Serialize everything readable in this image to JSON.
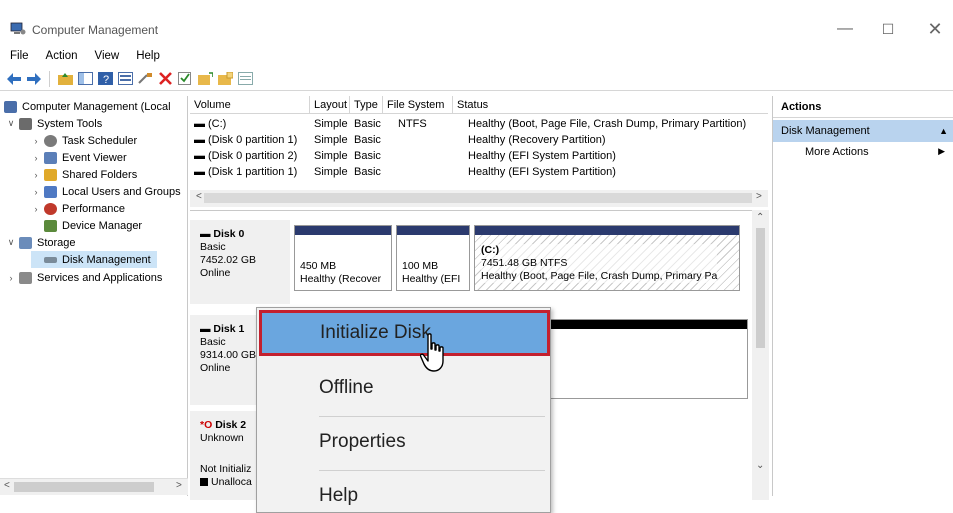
{
  "window": {
    "title": "Computer Management"
  },
  "menu": [
    "File",
    "Action",
    "View",
    "Help"
  ],
  "tree": {
    "items": [
      {
        "label": "Computer Management (Local",
        "expander": "",
        "icon_color": "#4a6ea9"
      },
      {
        "label": "System Tools",
        "expander": "∨",
        "icon_color": "#6b6b6b"
      },
      {
        "label": "Task Scheduler",
        "expander": "›",
        "icon_color": "#7a7a7a"
      },
      {
        "label": "Event Viewer",
        "expander": "›",
        "icon_color": "#5b7fb8"
      },
      {
        "label": "Shared Folders",
        "expander": "›",
        "icon_color": "#e0a92a"
      },
      {
        "label": "Local Users and Groups",
        "expander": "›",
        "icon_color": "#4f79c3"
      },
      {
        "label": "Performance",
        "expander": "›",
        "icon_color": "#c0392b"
      },
      {
        "label": "Device Manager",
        "expander": "",
        "icon_color": "#5b8a3c"
      },
      {
        "label": "Storage",
        "expander": "∨",
        "icon_color": "#6b8cba"
      },
      {
        "label": "Disk Management",
        "expander": "",
        "icon_color": "#7a8b99"
      },
      {
        "label": "Services and Applications",
        "expander": "›",
        "icon_color": "#8a8a8a"
      }
    ]
  },
  "volumes": {
    "columns": [
      "Volume",
      "Layout",
      "Type",
      "File System",
      "Status"
    ],
    "rows": [
      {
        "volume": "(C:)",
        "layout": "Simple",
        "type": "Basic",
        "fs": "NTFS",
        "status": "Healthy (Boot, Page File, Crash Dump, Primary Partition)"
      },
      {
        "volume": "(Disk 0 partition 1)",
        "layout": "Simple",
        "type": "Basic",
        "fs": "",
        "status": "Healthy (Recovery Partition)"
      },
      {
        "volume": "(Disk 0 partition 2)",
        "layout": "Simple",
        "type": "Basic",
        "fs": "",
        "status": "Healthy (EFI System Partition)"
      },
      {
        "volume": "(Disk 1 partition 1)",
        "layout": "Simple",
        "type": "Basic",
        "fs": "",
        "status": "Healthy (EFI System Partition)"
      }
    ]
  },
  "disks": {
    "disk0": {
      "name": "Disk 0",
      "type": "Basic",
      "size": "7452.02 GB",
      "state": "Online",
      "partitions": [
        {
          "size": "450 MB",
          "status": "Healthy (Recover"
        },
        {
          "size": "100 MB",
          "status": "Healthy (EFI"
        },
        {
          "name": "(C:)",
          "size": "7451.48 GB NTFS",
          "status": "Healthy (Boot, Page File, Crash Dump, Primary Pa"
        }
      ]
    },
    "disk1": {
      "name": "Disk 1",
      "type": "Basic",
      "size": "9314.00 GB",
      "state": "Online"
    },
    "disk2": {
      "name": "Disk 2",
      "type": "Unknown",
      "state": "Not Initializ",
      "unallocated": "Unalloca"
    }
  },
  "actions": {
    "header": "Actions",
    "section": "Disk Management",
    "more": "More Actions"
  },
  "context_menu": {
    "items": [
      "Initialize Disk",
      "Offline",
      "Properties",
      "Help"
    ]
  }
}
